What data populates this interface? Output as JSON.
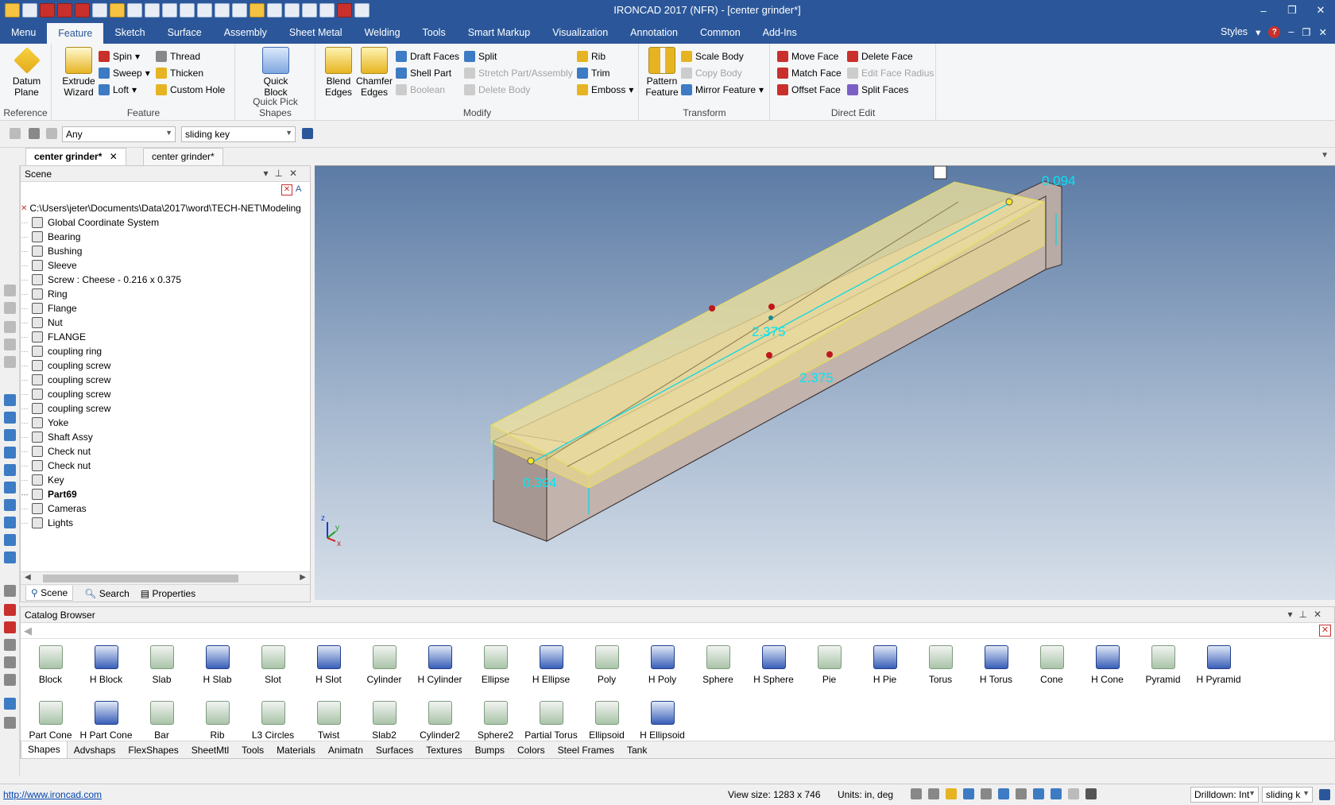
{
  "app": {
    "title": "IRONCAD 2017 (NFR) - [center grinder*]",
    "window_controls": [
      "–",
      "❐",
      "✕"
    ],
    "accent_color": "#2b579a"
  },
  "menubar": {
    "tabs": [
      "Menu",
      "Feature",
      "Sketch",
      "Surface",
      "Assembly",
      "Sheet Metal",
      "Welding",
      "Tools",
      "Smart Markup",
      "Visualization",
      "Annotation",
      "Common",
      "Add-Ins"
    ],
    "active_tab": "Feature",
    "styles_label": "Styles",
    "help_icon": "?"
  },
  "ribbon": {
    "reference": {
      "label": "Reference",
      "datum_plane": "Datum\nPlane"
    },
    "feature": {
      "label": "Feature",
      "extrude": "Extrude\nWizard",
      "spin": "Spin",
      "sweep": "Sweep",
      "loft": "Loft",
      "thread": "Thread",
      "thicken": "Thicken",
      "custom_hole": "Custom Hole"
    },
    "quick_pick": {
      "label": "Quick Pick Shapes",
      "quick_block": "Quick\nBlock"
    },
    "modify": {
      "label": "Modify",
      "blend": "Blend\nEdges",
      "chamfer": "Chamfer\nEdges",
      "draft_faces": "Draft Faces",
      "shell_part": "Shell Part",
      "boolean": "Boolean",
      "split": "Split",
      "stretch": "Stretch Part/Assembly",
      "delete_body": "Delete Body",
      "rib": "Rib",
      "trim": "Trim",
      "emboss": "Emboss"
    },
    "transform": {
      "label": "Transform",
      "pattern": "Pattern\nFeature",
      "scale_body": "Scale Body",
      "copy_body": "Copy Body",
      "mirror": "Mirror Feature"
    },
    "direct_edit": {
      "label": "Direct Edit",
      "move_face": "Move Face",
      "match_face": "Match Face",
      "offset_face": "Offset Face",
      "delete_face": "Delete Face",
      "edit_face_radius": "Edit Face Radius",
      "split_faces": "Split Faces"
    }
  },
  "toolbar": {
    "filter_value": "Any",
    "part_value": "sliding key"
  },
  "doc_tabs": [
    "center grinder*",
    "center grinder*"
  ],
  "scene": {
    "title": "Scene",
    "path": "C:\\Users\\jeter\\Documents\\Data\\2017\\word\\TECH-NET\\Modeling",
    "items": [
      {
        "label": "Global Coordinate System"
      },
      {
        "label": "Bearing"
      },
      {
        "label": "Bushing"
      },
      {
        "label": "Sleeve"
      },
      {
        "label": "Screw : Cheese - 0.216 x 0.375"
      },
      {
        "label": "Ring"
      },
      {
        "label": "Flange"
      },
      {
        "label": "Nut"
      },
      {
        "label": "FLANGE"
      },
      {
        "label": "coupling ring"
      },
      {
        "label": "coupling screw"
      },
      {
        "label": "coupling screw"
      },
      {
        "label": "coupling screw"
      },
      {
        "label": "coupling screw"
      },
      {
        "label": "Yoke"
      },
      {
        "label": "Shaft Assy"
      },
      {
        "label": "Check nut"
      },
      {
        "label": "Check nut"
      },
      {
        "label": "Key"
      },
      {
        "label": "Part69"
      },
      {
        "label": "Cameras"
      },
      {
        "label": "Lights"
      }
    ],
    "bottom_tabs": [
      "Scene",
      "Search",
      "Properties"
    ]
  },
  "viewport": {
    "dims": [
      "0.094",
      "2.375",
      "2.375",
      "0.394"
    ],
    "axis_labels": [
      "z",
      "y",
      "x"
    ]
  },
  "catalog": {
    "title": "Catalog Browser",
    "row1": [
      "Block",
      "H Block",
      "Slab",
      "H Slab",
      "Slot",
      "H Slot",
      "Cylinder",
      "H Cylinder",
      "Ellipse",
      "H Ellipse",
      "Poly",
      "H Poly",
      "Sphere",
      "H Sphere",
      "Pie",
      "H Pie",
      "Torus",
      "H Torus",
      "Cone",
      "H Cone",
      "Pyramid",
      "H Pyramid"
    ],
    "row2": [
      "Part Cone",
      "H Part Cone",
      "Bar",
      "Rib",
      "L3 Circles",
      "Twist",
      "Slab2",
      "Cylinder2",
      "Sphere2",
      "Partial Torus",
      "Ellipsoid",
      "H Ellipsoid"
    ],
    "tabs": [
      "Shapes",
      "Advshaps",
      "FlexShapes",
      "SheetMtl",
      "Tools",
      "Materials",
      "Animatn",
      "Surfaces",
      "Textures",
      "Bumps",
      "Colors",
      "Steel Frames",
      "Tank"
    ],
    "active_tab": "Shapes"
  },
  "status": {
    "url": "http://www.ironcad.com",
    "view_size": "View size: 1283 x 746",
    "units": "Units: in, deg",
    "drilldown": "Drilldown: Int",
    "part": "sliding k"
  }
}
